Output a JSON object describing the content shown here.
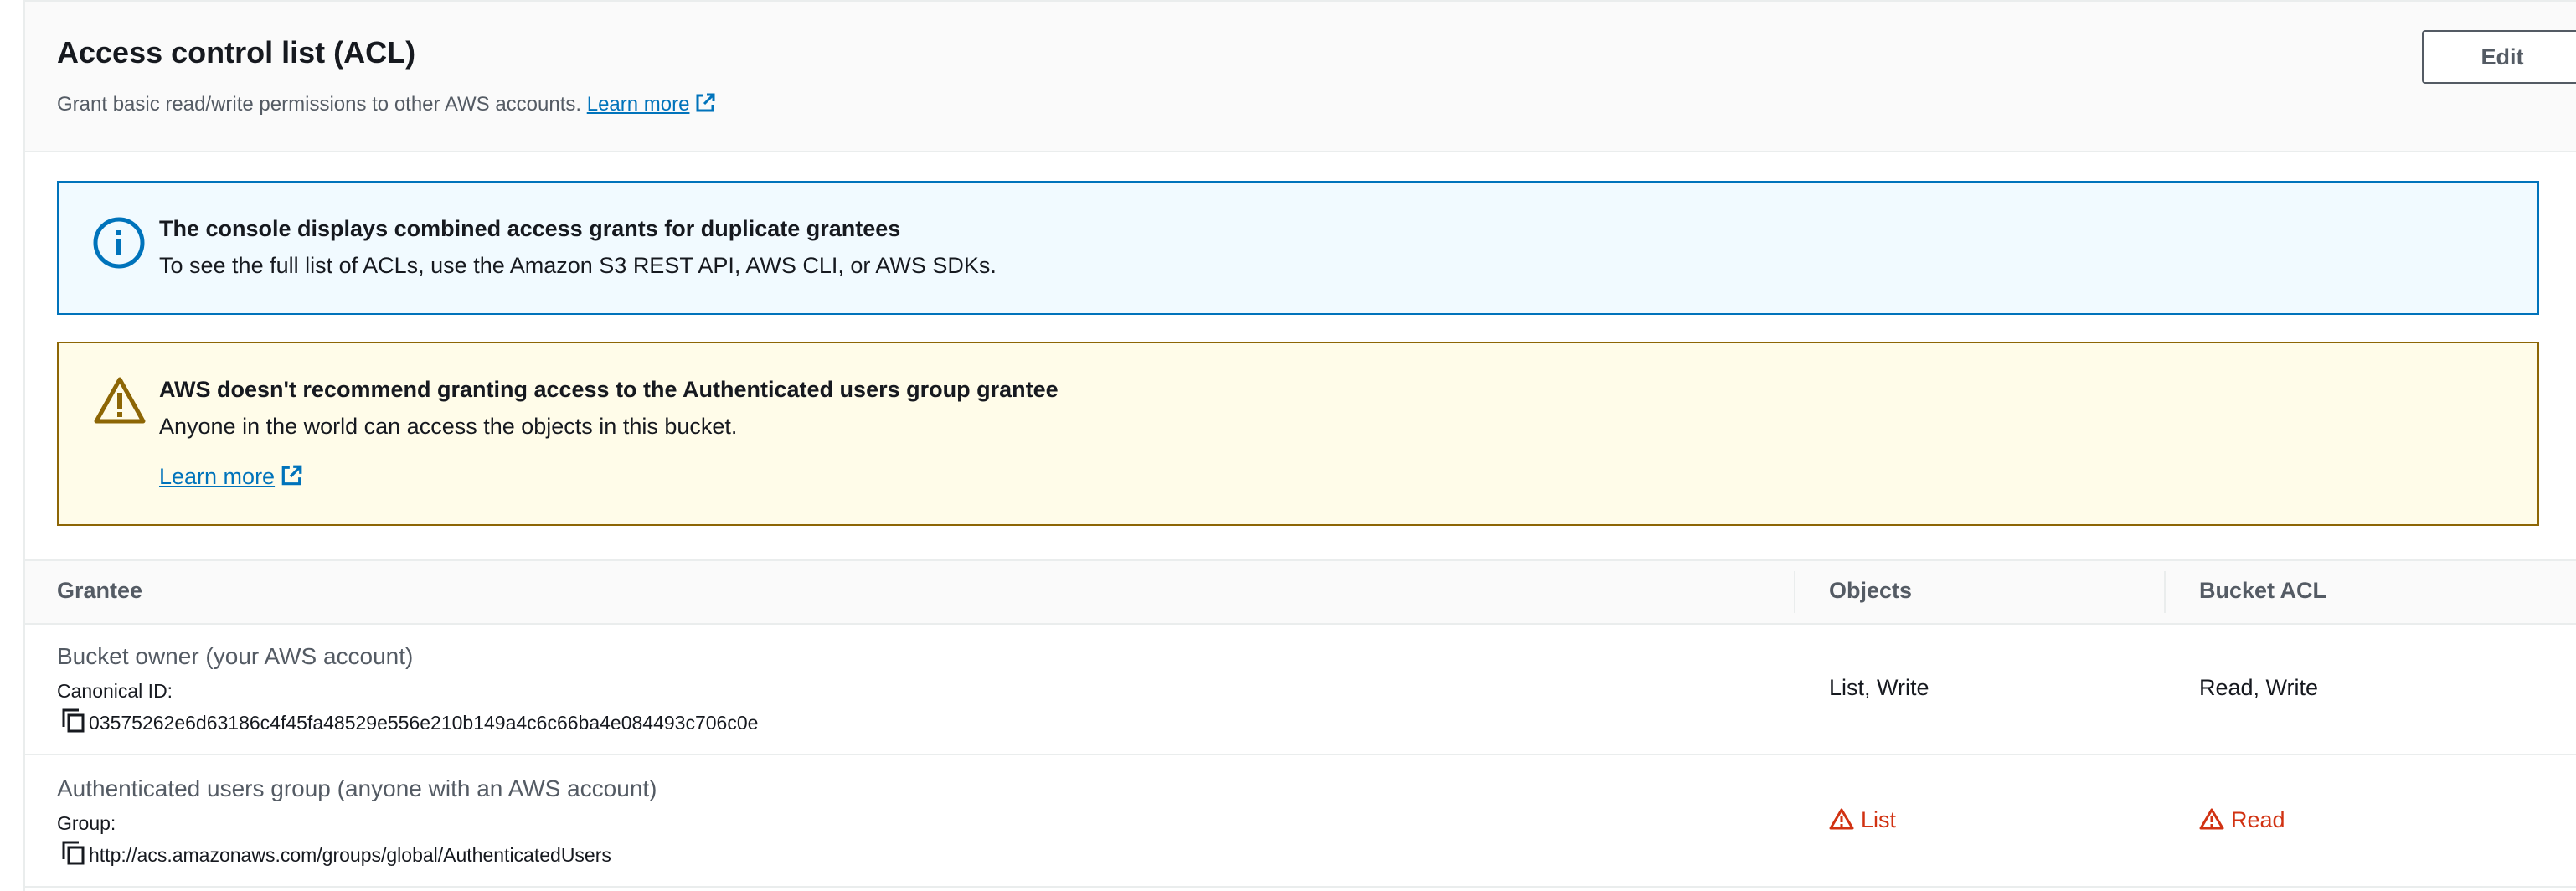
{
  "header": {
    "title": "Access control list (ACL)",
    "description": "Grant basic read/write permissions to other AWS accounts.",
    "learn_more": "Learn more",
    "edit_label": "Edit"
  },
  "info_alert": {
    "title": "The console displays combined access grants for duplicate grantees",
    "body": "To see the full list of ACLs, use the Amazon S3 REST API, AWS CLI, or AWS SDKs.",
    "color": "#0073bb"
  },
  "warning_alert": {
    "title": "AWS doesn't recommend granting access to the Authenticated users group grantee",
    "body": "Anyone in the world can access the objects in this bucket.",
    "learn_more": "Learn more",
    "color": "#8d6605"
  },
  "table": {
    "columns": [
      "Grantee",
      "Objects",
      "Bucket ACL"
    ],
    "rows": [
      {
        "grantee": "Bucket owner (your AWS account)",
        "id_label": "Canonical ID:",
        "id_value": "03575262e6d63186c4f45fa48529e556e210b149a4c6c66ba4e084493c706c0e",
        "objects": "List, Write",
        "bucket_acl": "Read, Write",
        "warning": false
      },
      {
        "grantee": "Authenticated users group (anyone with an AWS account)",
        "id_label": "Group:",
        "id_value": "http://acs.amazonaws.com/groups/global/AuthenticatedUsers",
        "objects": "List",
        "bucket_acl": "Read",
        "warning": true
      }
    ]
  },
  "colors": {
    "link": "#0073bb",
    "warning_text": "#d13212",
    "info_bg": "#f1faff",
    "warn_bg": "#fffce9"
  }
}
